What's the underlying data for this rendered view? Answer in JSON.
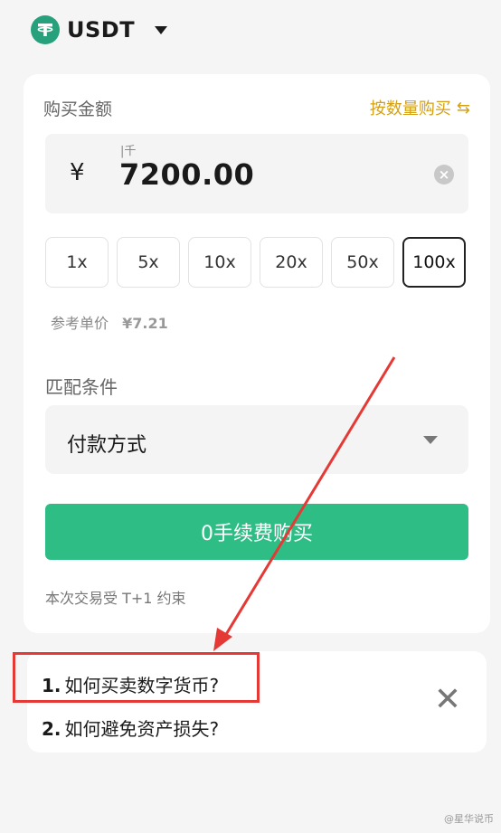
{
  "header": {
    "coin": "USDT"
  },
  "buy": {
    "amount_label": "购买金额",
    "switch_label": "按数量购买",
    "swap_icon": "⇆",
    "unit_hint": "|千",
    "currency_symbol": "¥",
    "amount_value": "7200.00",
    "clear_icon": "×",
    "multipliers": [
      "1x",
      "5x",
      "10x",
      "20x",
      "50x",
      "100x"
    ],
    "active_multiplier": "100x",
    "ref_price_label": "参考单价",
    "ref_price_value": "¥7.21",
    "match_label": "匹配条件",
    "payment_placeholder": "付款方式",
    "buy_button": "0手续费购买",
    "constraint_note": "本次交易受 T+1 约束"
  },
  "faq": {
    "items": [
      {
        "num": "1.",
        "text": "如何买卖数字货币?"
      },
      {
        "num": "2.",
        "text": "如何避免资产损失?"
      }
    ],
    "close_icon": "✕"
  },
  "watermark": "@星华说币",
  "colors": {
    "accent_green": "#2ebd85",
    "tether_green": "#26a17b",
    "gold": "#d4a017",
    "annotation_red": "#e53935"
  },
  "icons": {
    "coin": "tether-logo-icon",
    "dropdown": "caret-down-icon",
    "swap": "swap-arrows-icon",
    "clear": "clear-circle-icon",
    "close": "close-icon"
  }
}
